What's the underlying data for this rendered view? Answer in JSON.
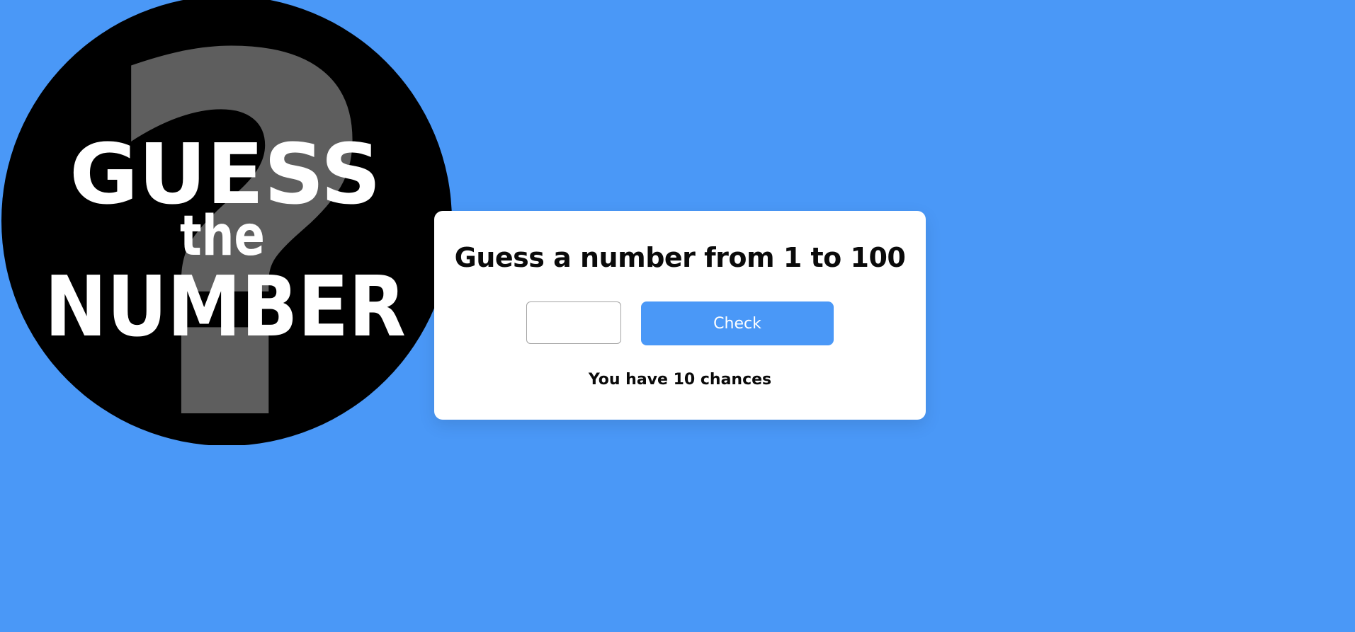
{
  "logo": {
    "line1": "GUESS",
    "line2": "the",
    "line3": "NUMBER",
    "question_mark": "?"
  },
  "game": {
    "heading": "Guess a number from 1 to 100",
    "input_value": "",
    "input_placeholder": "",
    "check_label": "Check",
    "chances_text": "You have 10 chances"
  },
  "colors": {
    "background": "#4a98f7",
    "card": "#ffffff",
    "button": "#4a98f7",
    "logo_circle": "#000000",
    "logo_question_mark": "#5e5e5e"
  }
}
